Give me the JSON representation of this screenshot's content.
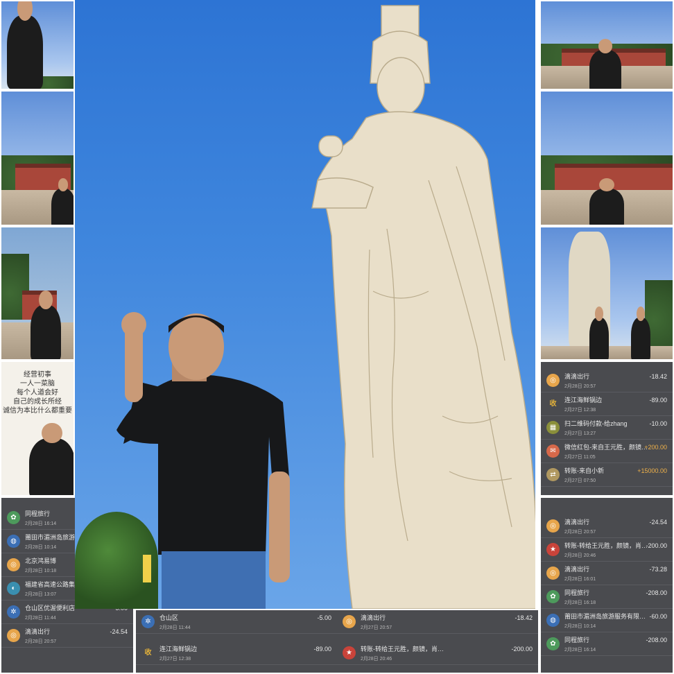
{
  "photo": {
    "statue_color": "#e9dfc9",
    "sky_color": "#3f86dd",
    "shirt_color": "#17181a",
    "jeans_color": "#3f6fb2"
  },
  "note_card": {
    "lines": [
      "经营初事",
      "一人一菜脑",
      "每个人道会好",
      "自己的成长所经",
      "诚信为本比什么都重要"
    ]
  },
  "ledger_right": [
    {
      "icon": "didi-icon",
      "name": "滴滴出行",
      "time": "2月28日 20:57",
      "amount": "-18.42",
      "color": "#e7a54b"
    },
    {
      "icon": "shou-icon",
      "name": "连江海鲜锅边",
      "time": "2月27日 12:38",
      "amount": "-89.00",
      "color": "#c9962b"
    },
    {
      "icon": "qr-icon",
      "name": "扫二维码付款-给zhang",
      "time": "2月27日 13:27",
      "amount": "-10.00",
      "color": "#8a8f3a"
    },
    {
      "icon": "hongbao-icon",
      "name": "微信红包-来自王元胜，颜镜，肖...",
      "time": "2月27日 11:05",
      "amount": "+200.00",
      "color": "#d6684a"
    },
    {
      "icon": "transfer-icon",
      "name": "转账-来自小新",
      "time": "2月27日 07:50",
      "amount": "+15000.00",
      "color": "#b09860"
    }
  ],
  "ledger_right_bottom": [
    {
      "icon": "didi-icon",
      "name": "滴滴出行",
      "time": "2月28日 20:57",
      "amount": "-24.54",
      "color": "#e7a54b"
    },
    {
      "icon": "transfer-icon",
      "name": "转账-转给王元胜，颜镜，肖腰，肖",
      "time": "2月28日 20:46",
      "amount": "-200.00",
      "color": "#c9433a"
    },
    {
      "icon": "didi-icon",
      "name": "滴滴出行",
      "time": "2月28日 16:01",
      "amount": "-73.28",
      "color": "#e7a54b"
    },
    {
      "icon": "tongcheng-icon",
      "name": "同程旅行",
      "time": "2月28日 16:18",
      "amount": "-208.00",
      "color": "#4d9a5c"
    },
    {
      "icon": "putian-icon",
      "name": "莆田市湄洲岛旅游服务有限公司",
      "time": "2月28日 10:14",
      "amount": "-60.00",
      "color": "#3b6fb5"
    },
    {
      "icon": "tongcheng-icon",
      "name": "同程旅行",
      "time": "2月28日 16:14",
      "amount": "-208.00",
      "color": "#4d9a5c"
    }
  ],
  "ledger_left_bottom": [
    {
      "icon": "tongcheng-icon",
      "name": "同程旅行",
      "time": "2月28日 16:14",
      "color": "#4d9a5c"
    },
    {
      "icon": "putian-icon",
      "name": "莆田市湄洲岛旅游服",
      "time": "2月28日 10:14",
      "color": "#3b6fb5"
    },
    {
      "icon": "didi-icon",
      "name": "北京鸿易博",
      "time": "2月28日 10:18",
      "color": "#e7a54b"
    },
    {
      "icon": "highway-icon",
      "name": "福建省高速公路集团有",
      "time": "2月28日 13:07",
      "color": "#3a8fb0"
    },
    {
      "icon": "shop-icon",
      "name": "仓山区优渥便利店",
      "time": "2月28日 11:44",
      "amount": "-5.00",
      "color": "#3b6fb5"
    },
    {
      "icon": "didi-icon",
      "name": "滴滴出行",
      "time": "2月28日 20:57",
      "amount": "-24.54",
      "color": "#e7a54b"
    }
  ],
  "ledger_bottom": [
    {
      "icon": "shop-icon",
      "name": "仓山区",
      "time": "2月28日 11:44",
      "amount": "-5.00",
      "color": "#3b6fb5"
    },
    {
      "icon": "didi-icon",
      "name": "滴滴出行",
      "time": "2月27日 20:57",
      "amount": "-18.42",
      "color": "#e7a54b"
    },
    {
      "icon": "shou-icon",
      "name": "连江海鲜锅边",
      "time": "2月27日 12:38",
      "amount": "-89.00",
      "color": "#c9962b"
    },
    {
      "icon": "transfer-icon",
      "name": "转账-转给王元胜，颜镜，肖腰...",
      "time": "2月28日 20:46",
      "amount": "-200.00",
      "color": "#c9433a"
    }
  ]
}
